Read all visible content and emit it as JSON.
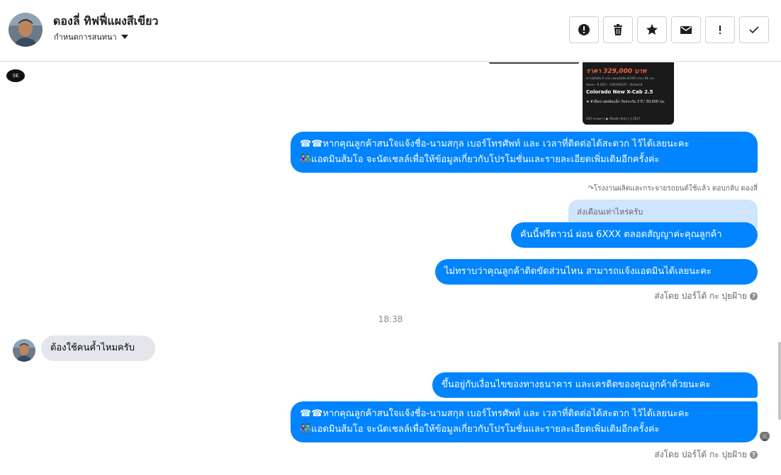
{
  "header": {
    "contact_name": "ดองลี่ ทิฟฟี่แผงสีเขียว",
    "subtitle": "กำหนดการสนทนา",
    "toolbar": [
      {
        "name": "report-button",
        "icon": "alert-circle-icon"
      },
      {
        "name": "delete-button",
        "icon": "trash-icon"
      },
      {
        "name": "star-button",
        "icon": "star-icon"
      },
      {
        "name": "mail-button",
        "icon": "envelope-icon"
      },
      {
        "name": "flag-button",
        "icon": "exclamation-icon"
      },
      {
        "name": "done-button",
        "icon": "check-icon"
      }
    ]
  },
  "ad_card": {
    "price": "ราคา 329,000 บาท",
    "line1": "ดาวน์เริ่มต้น 0 บาท | ผ่อนเริ่มต้น 6,XXX บาท | 84 งวด",
    "line2": "มือสอง · ปี 2017 · CHEVROLET · เกียร์ออโต้",
    "model": "Colorado New X-Cab 2.5",
    "desc": "★ ตัวท็อป แต่งล้อแม็ก รับประกัน 3 ปี / 30,000 กม.",
    "footer": "เกียร์ ธรรมดา | ● เชื้อเพลิง ดีเซล | ◷ 2017"
  },
  "logo_badge": "SK",
  "messages": {
    "promo_1_line1": "☎☎หากคุณลูกค้าสนใจแจ้งชื่อ-นามสกุล เบอร์โทรศัพท์ และ เวลาที่ติดต่อได้สะดวก ไว้ได้เลยนะคะ",
    "promo_1_line2": "👫แอดมินส้มโอ จะนัดเชลล์เพื่อให้ข้อมูลเกี่ยวกับโปรโมชั่นและรายละเอียดเพิ่มเติมอีกครั้งค่ะ",
    "reply_note": "↷โรงงานผลิตและกระจายรถยนต์ใช้แล้ว ตอบกลับ ดองลี่",
    "quoted": "ส่งเดือนเท่าไหร่ครับ",
    "reply_answer": "คันนี้ฟรีดาวน์ ผ่อน 6XXX ตลอดสัญญาค่ะคุณลูกค้า",
    "unknown_msg": "ไม่ทราบว่าคุณลูกค้าติดขัดส่วนไหน สามารถแจ้งแอดมินได้เลยนะคะ",
    "sent_by_1": "ส่งโดย ปอร์โต้ กะ ปุยฝ้าย",
    "time": "18:38",
    "incoming": "ต้องใช้คนค้ำไหมครับ",
    "bank_msg": "ขึ้นอยู่กับเงื่อนไขของทางธนาคาร และเครดิตของคุณลูกค้าด้วยนะคะ",
    "promo_2_line1": "☎☎หากคุณลูกค้าสนใจแจ้งชื่อ-นามสกุล เบอร์โทรศัพท์ และ เวลาที่ติดต่อได้สะดวก ไว้ได้เลยนะคะ",
    "promo_2_line2": "👫แอดมินส้มโอ จะนัดเชลล์เพื่อให้ข้อมูลเกี่ยวกับโปรโมชั่นและรายละเอียดเพิ่มเติมอีกครั้งค่ะ",
    "sent_by_2": "ส่งโดย ปอร์โต้ กะ ปุยฝ้าย"
  },
  "colors": {
    "outgoing": "#0084ff",
    "incoming": "#e4e6eb",
    "quote": "#cfe4fd"
  }
}
